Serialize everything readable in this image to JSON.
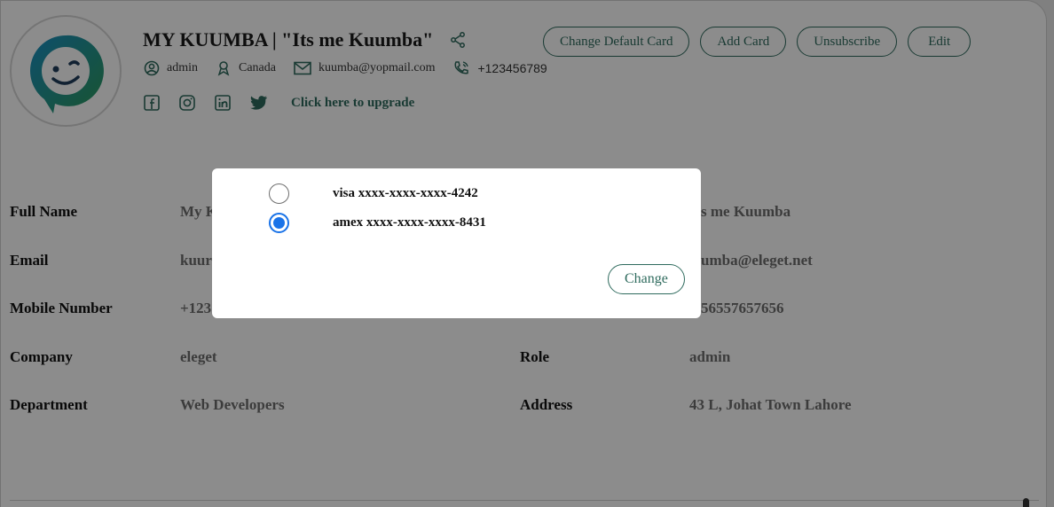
{
  "profile": {
    "title": "MY KUUMBA | \"Its me Kuumba\"",
    "role": "admin",
    "country": "Canada",
    "email": "kuumba@yopmail.com",
    "phone": "+123456789",
    "upgrade_link": "Click here to upgrade"
  },
  "header_buttons": {
    "change_default_card": "Change Default Card",
    "add_card": "Add Card",
    "unsubscribe": "Unsubscribe",
    "edit": "Edit"
  },
  "social_icons": [
    "facebook-icon",
    "instagram-icon",
    "linkedin-icon",
    "twitter-icon"
  ],
  "details": [
    {
      "label": "Full Name",
      "value": "My K"
    },
    {
      "label": "Email",
      "value": "kuur"
    },
    {
      "label": "Mobile Number",
      "value": "+123"
    },
    {
      "label": "Company",
      "value": "eleget"
    },
    {
      "label": "Department",
      "value": "Web Developers"
    }
  ],
  "details_right": [
    {
      "label": "",
      "value": "s me Kuumba"
    },
    {
      "label": "",
      "value": "umba@eleget.net"
    },
    {
      "label": "",
      "value": "56557657656"
    },
    {
      "label": "Role",
      "value": "admin"
    },
    {
      "label": "Address",
      "value": "43 L, Johat Town Lahore"
    }
  ],
  "modal": {
    "options": [
      {
        "label": "visa xxxx-xxxx-xxxx-4242",
        "selected": false
      },
      {
        "label": "amex xxxx-xxxx-xxxx-8431",
        "selected": true
      }
    ],
    "change_button": "Change"
  },
  "colors": {
    "accent": "#2f6b5e",
    "radio_selected": "#1a73e8",
    "overlay": "rgba(0,0,0,0.45)"
  }
}
